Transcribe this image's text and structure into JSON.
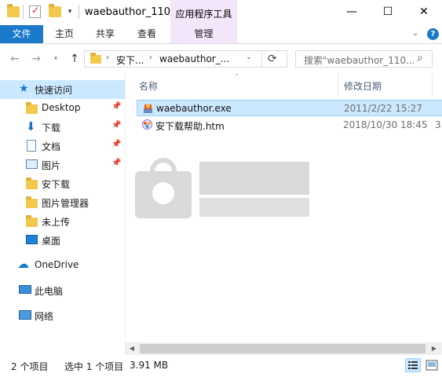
{
  "window": {
    "title": "waebauthor_110...",
    "context_tab_header": "应用程序工具",
    "controls": {
      "minimize": "—",
      "maximize": "☐",
      "close": "✕"
    }
  },
  "ribbon": {
    "tabs": [
      {
        "label": "文件"
      },
      {
        "label": "主页"
      },
      {
        "label": "共享"
      },
      {
        "label": "查看"
      },
      {
        "label": "管理"
      }
    ]
  },
  "address": {
    "crumbs": [
      "安下...",
      "waebauthor_..."
    ],
    "search_placeholder": "搜索\"waebauthor_110..."
  },
  "sidebar": {
    "items": [
      {
        "label": "快速访问",
        "icon": "star-icon"
      },
      {
        "label": "Desktop",
        "icon": "folder-icon",
        "pinned": true
      },
      {
        "label": "下载",
        "icon": "download-icon",
        "pinned": true
      },
      {
        "label": "文档",
        "icon": "document-icon",
        "pinned": true
      },
      {
        "label": "图片",
        "icon": "pictures-icon",
        "pinned": true
      },
      {
        "label": "安下载",
        "icon": "folder-icon"
      },
      {
        "label": "图片管理器",
        "icon": "folder-icon"
      },
      {
        "label": "未上传",
        "icon": "folder-icon"
      },
      {
        "label": "桌面",
        "icon": "desktop-icon"
      },
      {
        "label": "OneDrive",
        "icon": "cloud-icon"
      },
      {
        "label": "此电脑",
        "icon": "computer-icon"
      },
      {
        "label": "网络",
        "icon": "network-icon"
      }
    ]
  },
  "file_list": {
    "columns": [
      "名称",
      "修改日期"
    ],
    "rows": [
      {
        "name": "waebauthor.exe",
        "date": "2011/2/22 15:27",
        "overflow": "",
        "icon": "installer-icon",
        "selected": true
      },
      {
        "name": "安下载帮助.htm",
        "date": "2018/10/30 18:45",
        "overflow": "3",
        "icon": "html-file-icon",
        "selected": false
      }
    ]
  },
  "status": {
    "item_count": "2 个项目",
    "selection": "选中 1 个项目",
    "size": "3.91 MB"
  },
  "colors": {
    "accent": "#1979ca",
    "selection": "#cce8ff",
    "context_tab": "#f3e6fa"
  }
}
